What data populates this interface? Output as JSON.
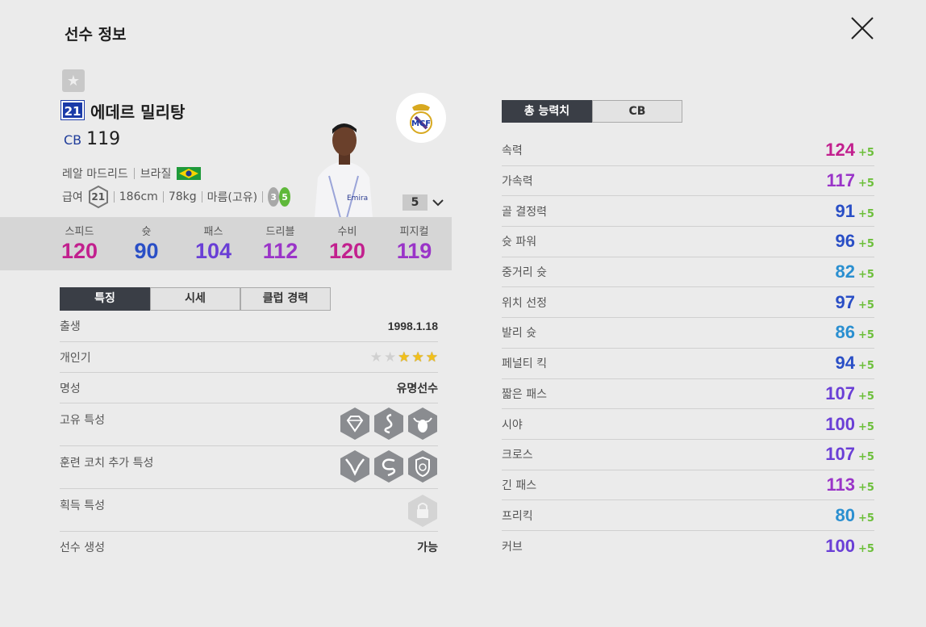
{
  "header": {
    "title": "선수 정보"
  },
  "player": {
    "number": "21",
    "name": "에데르 밀리탕",
    "position": "CB",
    "overall": "119",
    "club": "레알 마드리드",
    "nation": "브라질",
    "salary_label": "급여",
    "salary": "21",
    "height": "186cm",
    "weight": "78kg",
    "body_type": "마름(고유)",
    "weak_foot": "3",
    "strong_foot": "5",
    "upgrade_level": "5"
  },
  "summary_stats": [
    {
      "label": "스피드",
      "value": "120",
      "color": "#c2208e"
    },
    {
      "label": "슛",
      "value": "90",
      "color": "#2a4fc6"
    },
    {
      "label": "패스",
      "value": "104",
      "color": "#6a3fd6"
    },
    {
      "label": "드리블",
      "value": "112",
      "color": "#9a34c8"
    },
    {
      "label": "수비",
      "value": "120",
      "color": "#c2208e"
    },
    {
      "label": "피지컬",
      "value": "119",
      "color": "#9a34c8"
    }
  ],
  "left_tabs": [
    "특징",
    "시세",
    "클럽 경력"
  ],
  "features": {
    "birth_label": "출생",
    "birth": "1998.1.18",
    "popularity_label": "개인기",
    "popularity_stars": 3,
    "fame_label": "명성",
    "fame": "유명선수",
    "unique_traits_label": "고유 특성",
    "coach_traits_label": "훈련 코치 추가 특성",
    "acquired_traits_label": "획득 특성",
    "creation_label": "선수 생성",
    "creation": "가능"
  },
  "right_tabs": [
    "총 능력치",
    "CB"
  ],
  "attributes": [
    {
      "label": "속력",
      "value": "124",
      "bonus": "+5",
      "color": "#c2208e"
    },
    {
      "label": "가속력",
      "value": "117",
      "bonus": "+5",
      "color": "#9a34c8"
    },
    {
      "label": "골 결정력",
      "value": "91",
      "bonus": "+5",
      "color": "#2a4fc6"
    },
    {
      "label": "슛 파워",
      "value": "96",
      "bonus": "+5",
      "color": "#2a4fc6"
    },
    {
      "label": "중거리 슛",
      "value": "82",
      "bonus": "+5",
      "color": "#2a8fd0"
    },
    {
      "label": "위치 선정",
      "value": "97",
      "bonus": "+5",
      "color": "#2a4fc6"
    },
    {
      "label": "발리 슛",
      "value": "86",
      "bonus": "+5",
      "color": "#2a8fd0"
    },
    {
      "label": "페널티 킥",
      "value": "94",
      "bonus": "+5",
      "color": "#2a4fc6"
    },
    {
      "label": "짧은 패스",
      "value": "107",
      "bonus": "+5",
      "color": "#6a3fd6"
    },
    {
      "label": "시야",
      "value": "100",
      "bonus": "+5",
      "color": "#6a3fd6"
    },
    {
      "label": "크로스",
      "value": "107",
      "bonus": "+5",
      "color": "#6a3fd6"
    },
    {
      "label": "긴 패스",
      "value": "113",
      "bonus": "+5",
      "color": "#9a34c8"
    },
    {
      "label": "프리킥",
      "value": "80",
      "bonus": "+5",
      "color": "#2a8fd0"
    },
    {
      "label": "커브",
      "value": "100",
      "bonus": "+5",
      "color": "#6a3fd6"
    }
  ]
}
